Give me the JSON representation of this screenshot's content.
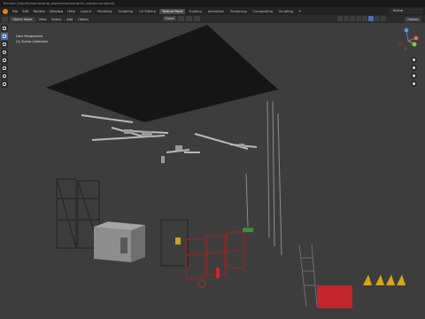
{
  "window": {
    "title": "Blender [/a/path/to/industrial_warehouse/industrial_warehouse.blend]"
  },
  "menus": [
    "File",
    "Edit",
    "Render",
    "Window",
    "Help"
  ],
  "workspace_tabs": [
    {
      "label": "Layout",
      "active": false
    },
    {
      "label": "Modeling",
      "active": false
    },
    {
      "label": "Sculpting",
      "active": false
    },
    {
      "label": "UV Editing",
      "active": false
    },
    {
      "label": "Texture Paint",
      "active": true
    },
    {
      "label": "Shading",
      "active": false
    },
    {
      "label": "Animation",
      "active": false
    },
    {
      "label": "Rendering",
      "active": false
    },
    {
      "label": "Compositing",
      "active": false
    },
    {
      "label": "Scripting",
      "active": false
    }
  ],
  "scene_name": "Scene",
  "header": {
    "mode": "Object Mode",
    "menus": [
      "View",
      "Select",
      "Add",
      "Object"
    ],
    "transform_orientation": "Global",
    "options": "Options"
  },
  "overlay": {
    "perspective": "User Perspective",
    "collection": "(1) Scene Collection"
  },
  "gizmo": {
    "x": "X",
    "y": "Y",
    "z": "Z"
  },
  "colors": {
    "accent": "#4772b3",
    "viewport_bg": "#3d3d3d",
    "x_axis": "#e05050",
    "y_axis": "#80c040",
    "z_axis": "#4a80e0"
  },
  "icons": {
    "tools": [
      "cursor-icon",
      "select-box-icon",
      "move-icon",
      "rotate-icon",
      "scale-icon",
      "transform-icon",
      "annotate-icon",
      "measure-icon"
    ],
    "nav": [
      "zoom-icon",
      "hand-pan-icon",
      "camera-view-icon",
      "grid-view-icon"
    ]
  }
}
